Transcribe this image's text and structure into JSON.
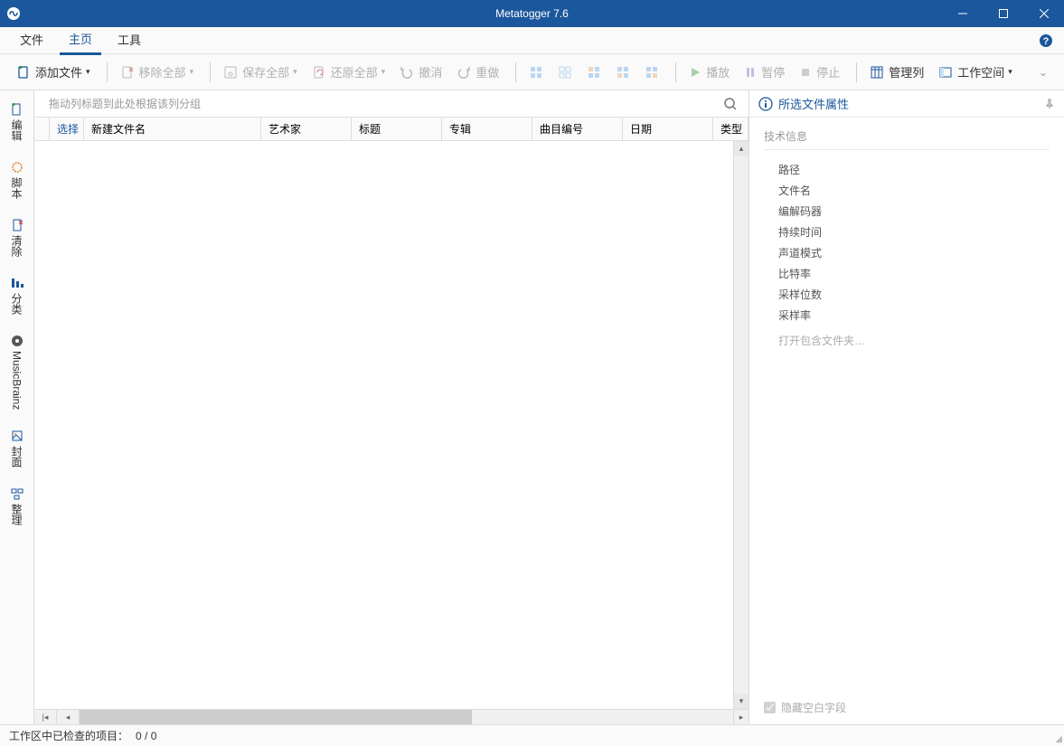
{
  "title": "Metatogger 7.6",
  "menu": {
    "file": "文件",
    "home": "主页",
    "tools": "工具"
  },
  "toolbar": {
    "addFile": "添加文件",
    "removeAll": "移除全部",
    "saveAll": "保存全部",
    "restoreAll": "还原全部",
    "undo": "撤消",
    "redo": "重做",
    "play": "播放",
    "pause": "暂停",
    "stop": "停止",
    "manageCols": "管理列",
    "workspace": "工作空间"
  },
  "sidebar": {
    "edit": "编辑",
    "script": "脚本",
    "clean": "清除",
    "sort": "分类",
    "musicbrainz": "MusicBrainz",
    "cover": "封面",
    "organize": "整理"
  },
  "grid": {
    "groupHint": "拖动列标题到此处根据该列分组",
    "cols": {
      "select": "选择",
      "newFilename": "新建文件名",
      "artist": "艺术家",
      "title": "标题",
      "album": "专辑",
      "trackNo": "曲目编号",
      "date": "日期",
      "genre": "类型"
    }
  },
  "rightPanel": {
    "title": "所选文件属性",
    "section": "技术信息",
    "fields": {
      "path": "路径",
      "filename": "文件名",
      "codec": "编解码器",
      "duration": "持续时间",
      "channelMode": "声道模式",
      "bitrate": "比特率",
      "sampleBits": "采样位数",
      "sampleRate": "采样率"
    },
    "openFolder": "打开包含文件夹…",
    "hideEmpty": "隐藏空白字段"
  },
  "status": {
    "label": "工作区中已检查的项目：",
    "value": "0 / 0"
  }
}
